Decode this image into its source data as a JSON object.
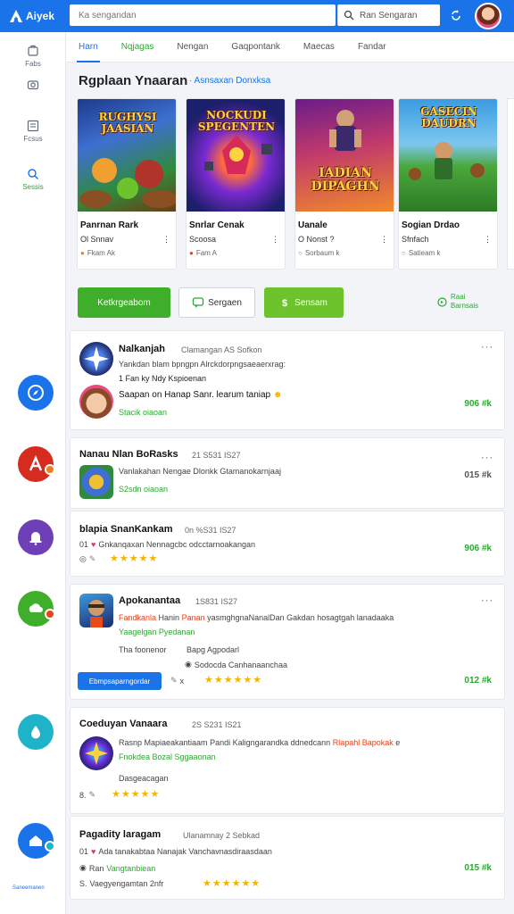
{
  "app": {
    "logo_text": "Aiyek"
  },
  "search": {
    "placeholder": "Ka sengandan",
    "button_label": "Ran Sengaran"
  },
  "sidebar": {
    "items": [
      {
        "label": "Fabs"
      },
      {
        "label": ""
      },
      {
        "label": "Fcsus"
      },
      {
        "label": "Sessis"
      }
    ],
    "app_label": "Saneemanen"
  },
  "tabs": [
    {
      "label": "Harn"
    },
    {
      "label": "Nqjagas"
    },
    {
      "label": "Nengan"
    },
    {
      "label": "Gaqpontank"
    },
    {
      "label": "Maecas"
    },
    {
      "label": "Fandar"
    }
  ],
  "section": {
    "title": "Rgplaan Ynaaran",
    "link": "· Asnsaxan Donxksa"
  },
  "cards": [
    {
      "art": "RUGHYSI JAASIAN",
      "title": "Panrnan Rark",
      "sub": "Ol Snnav",
      "meta": "Fkam Ak"
    },
    {
      "art": "NOCKUDI SPEGENTEN",
      "title": "Snrlar Cenak",
      "sub": "Scoosa",
      "meta": "Fam A"
    },
    {
      "art": "IADIAN DIPAGHN",
      "title": "Uanale",
      "sub": "O Nonst ?",
      "meta": "Sorbaum k"
    },
    {
      "art": "GASECIN DAUDRN",
      "title": "Sogian Drdao",
      "sub": "Sfnfach",
      "meta": "Satieam k"
    }
  ],
  "actions": {
    "primary": "Ketkrgeabom",
    "secondary": "Sergaen",
    "tertiary": "Sensam",
    "side_link_line1": "Raai",
    "side_link_line2": "Barnsais"
  },
  "posts": [
    {
      "name": "Nalkanjah",
      "time": "Clamangan   AS Sofkon",
      "line1": "Yankdan blam bpngpn Alrckdorpngsaeaerxrag:",
      "line2": "1 Fan  ky  Ndy Kspioenan",
      "reply_name": "Saapan on Hanap Sanr. learum taniap",
      "reply_meta": "Stacik oiaoan",
      "count": "906  #k"
    },
    {
      "name": "Nanau Nlan BoRasks",
      "time": "21  S531 IS27",
      "line1": "Vanlakahan Nengae Dlonkk Gtamanokarnjaaj",
      "line2": "S2sdn oiaoan",
      "count": "015  #k"
    },
    {
      "name": "blapia SnanKankam",
      "time": "0n  %S31 IS27",
      "line1": "Gnkanqaxan Nennagcbc odcctarnoakangan",
      "count": "906  #k"
    },
    {
      "name": "Apokanantaa",
      "time": "1S831 IS27",
      "line1_red": "Fandkanla",
      "line1_a": "Hanin",
      "line1_b": "Panan",
      "line1_c": "yasmghgnaNanalDan  Gakdan hosagtgah lanadaaka",
      "line2": "Yaagelgan Pyedanan",
      "line3a": "Tha foonenor",
      "line3b": "Bapg Agpodarl",
      "line4": "Sodocda  Canhanaanchaa",
      "button": "Ebmpsaparngordar",
      "mini": "x",
      "count": "012  #k"
    },
    {
      "name": "Coeduyan Vanaara",
      "time": "2S  S231 IS21",
      "line1a": "Rasnp  Mapiaeakantiaam",
      "line1b": "Pandi  Kaligngarandka  ddnedcann",
      "line1c": "Rlapahl Bapokak",
      "line1d": "e",
      "line2": "Fnokdea Bozal Sggaaonan",
      "line3": "Dasgeacagan",
      "mini": "8."
    },
    {
      "name": "Pagadity laragam",
      "time": "Ulanamnay   2 Sebkad",
      "line1": "Ada tanakabtaa Nanajak Vanchavnasdiraasdaan",
      "line2a": "Ran",
      "line2b": "Vangtanbiean",
      "line3a": "S.",
      "line3b": "Vaegyengamtan 2nfr",
      "count": "015  #k"
    }
  ]
}
